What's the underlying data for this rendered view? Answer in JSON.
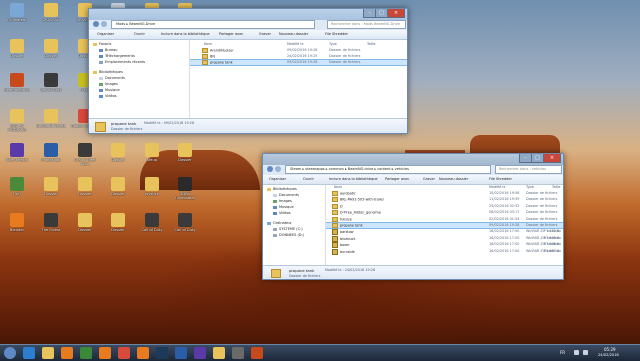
{
  "window1": {
    "address": [
      "Mods",
      "BeamNG.Drive"
    ],
    "search_placeholder": "Rechercher dans : Mods BeamNG.Drive",
    "toolbar": {
      "organize": "Organiser",
      "open": "Ouvrir",
      "include": "Inclure dans la bibliothèque",
      "share": "Partager avec",
      "burn": "Graver",
      "new_folder": "Nouveau dossier",
      "shredder": "File Shredder"
    },
    "nav": [
      "Favoris",
      "Bureau",
      "Téléchargements",
      "Emplacements récents",
      "Bibliothèques",
      "Documents",
      "Images",
      "Musique",
      "Vidéos"
    ],
    "columns": {
      "name": "Nom",
      "modified": "Modifié le",
      "type": "Type",
      "size": "Taille"
    },
    "files": [
      {
        "name": "ArendiHLoiser",
        "modified": "09/02/2016 19:28",
        "type": "Dossier de fichiers",
        "size": ""
      },
      {
        "name": "BN",
        "modified": "24/02/2016 19:25",
        "type": "Dossier de fichiers",
        "size": ""
      },
      {
        "name": "propane tank",
        "modified": "09/02/2016 19:28",
        "type": "Dossier de fichiers",
        "size": ""
      }
    ],
    "details": {
      "name": "propane tank",
      "modified": "Modifié le : 09/02/2016 19:28",
      "type": "Dossier de fichiers"
    }
  },
  "window2": {
    "address": [
      "Steam",
      "steamapps",
      "common",
      "BeamNG.drive",
      "content",
      "vehicles"
    ],
    "search_placeholder": "Rechercher dans : vehicles",
    "toolbar": {
      "organize": "Organiser",
      "open": "Ouvrir",
      "include": "Inclure dans la bibliothèque",
      "share": "Partager avec",
      "burn": "Graver",
      "new_folder": "Nouveau dossier",
      "shredder": "File Shredder"
    },
    "nav": [
      "Bibliothèques",
      "Documents",
      "Images",
      "Musique",
      "Vidéos",
      "Ordinateur",
      "SYSTEME (C:)",
      "DONNEES (D:)"
    ],
    "columns": {
      "name": "Nom",
      "modified": "Modifié le",
      "type": "Type",
      "size": "Taille"
    },
    "files": [
      {
        "name": "aerobatic",
        "modified": "10/02/2016 19:56",
        "type": "Dossier de fichiers",
        "size": "",
        "kind": "folder"
      },
      {
        "name": "BKL-Mkll2-505-with-trailer",
        "modified": "11/02/2016 19:39",
        "type": "Dossier de fichiers",
        "size": "",
        "kind": "folder"
      },
      {
        "name": "D",
        "modified": "25/02/2016 02:52",
        "type": "Dossier de fichiers",
        "size": "",
        "kind": "folder"
      },
      {
        "name": "D-Tiree_Addon_genoima",
        "modified": "06/02/2016 03:17",
        "type": "Dossier de fichiers",
        "size": "",
        "kind": "folder"
      },
      {
        "name": "fullsize",
        "modified": "02/02/2016 01:54",
        "type": "Dossier de fichiers",
        "size": "",
        "kind": "folder"
      },
      {
        "name": "propane tank",
        "modified": "09/02/2016 19:28",
        "type": "Dossier de fichiers",
        "size": "",
        "kind": "folder"
      },
      {
        "name": "barstow",
        "modified": "16/02/2016 17:00",
        "type": "WinRAR ZIP archive",
        "size": "1 122 Ko",
        "kind": "zip"
      },
      {
        "name": "bluebuck",
        "modified": "16/02/2016 17:00",
        "type": "WinRAR ZIP archive",
        "size": "47 409 Ko",
        "kind": "zip"
      },
      {
        "name": "boxer",
        "modified": "16/02/2016 17:00",
        "type": "WinRAR ZIP archive",
        "size": "47 508 Ko",
        "kind": "zip"
      },
      {
        "name": "burnside",
        "modified": "16/02/2016 17:00",
        "type": "WinRAR ZIP archive",
        "size": "55 667 Ko",
        "kind": "zip"
      }
    ],
    "details": {
      "name": "propane tank",
      "modified": "Modifié le : 24/02/2016 19:28",
      "type": "Dossier de fichiers"
    }
  },
  "desktop_icons": [
    {
      "label": "Ordinateur",
      "color": "#7aa7d6"
    },
    {
      "label": "GRASSAN",
      "color": "#e8c25a"
    },
    {
      "label": "GRASSAN",
      "color": "#e8c25a"
    },
    {
      "label": "Corbeille",
      "color": "#c9d3df"
    },
    {
      "label": "Dossier",
      "color": "#e8c25a"
    },
    {
      "label": "Dossier",
      "color": "#e8c25a"
    },
    {
      "label": "Dossier",
      "color": "#e8c25a"
    },
    {
      "label": "Dossier",
      "color": "#e8c25a"
    },
    {
      "label": "Dossier",
      "color": "#e8c25a"
    },
    {
      "label": "Dossier",
      "color": "#e8c25a"
    },
    {
      "label": "Dossier",
      "color": "#e8c25a"
    },
    {
      "label": "Dossier",
      "color": "#e8c25a"
    },
    {
      "label": "Beamng.drive",
      "color": "#c84a1c"
    },
    {
      "label": "Call of Duty",
      "color": "#3a3a3a"
    },
    {
      "label": "Fraps",
      "color": "#c8c020"
    },
    {
      "label": "Steam",
      "color": "#1e3a5a"
    },
    {
      "label": "Game",
      "color": "#2a2a2a"
    },
    {
      "label": "Game",
      "color": "#2a2a2a"
    },
    {
      "label": "BO2 PC MODDING",
      "color": "#e8c25a"
    },
    {
      "label": "Standard Assets",
      "color": "#e8c25a"
    },
    {
      "label": "Google Chrome",
      "color": "#d84a3a"
    },
    {
      "label": "Adobe Photoshop",
      "color": "#2c5ea8"
    },
    {
      "label": "Grand Theft Auto",
      "color": "#3a3a3a"
    },
    {
      "label": "Grand Theft Auto",
      "color": "#3a3a3a"
    },
    {
      "label": "After Effects",
      "color": "#5a3aa8"
    },
    {
      "label": "Photoshop",
      "color": "#2c5ea8"
    },
    {
      "label": "Grand Theft Auto",
      "color": "#3a3a3a"
    },
    {
      "label": "Dossier",
      "color": "#e8c25a"
    },
    {
      "label": "setup",
      "color": "#e8c25a"
    },
    {
      "label": "Dossier",
      "color": "#e8c25a"
    },
    {
      "label": "FinO",
      "color": "#4a8a3a"
    },
    {
      "label": "Dossier",
      "color": "#e8c25a"
    },
    {
      "label": "Dossier",
      "color": "#e8c25a"
    },
    {
      "label": "Dossier",
      "color": "#e8c25a"
    },
    {
      "label": "joystick",
      "color": "#e8c25a"
    },
    {
      "label": "3DBit Unimodder",
      "color": "#2a2a2a"
    },
    {
      "label": "Blender",
      "color": "#e87a20"
    },
    {
      "label": "The Forest",
      "color": "#3a3a3a"
    },
    {
      "label": "Dossier",
      "color": "#e8c25a"
    },
    {
      "label": "Dossier",
      "color": "#e8c25a"
    },
    {
      "label": "Call of Duty",
      "color": "#3a3a3a"
    },
    {
      "label": "Call of Duty",
      "color": "#3a3a3a"
    }
  ],
  "taskbar": {
    "time": "05:29",
    "date": "24/02/2016",
    "language": "FR",
    "apps": [
      "start",
      "ie",
      "explorer",
      "firefox",
      "player",
      "vlc",
      "chrome",
      "firefox",
      "steam",
      "photoshop",
      "aftereffects",
      "explorer",
      "app",
      "beamng"
    ]
  }
}
